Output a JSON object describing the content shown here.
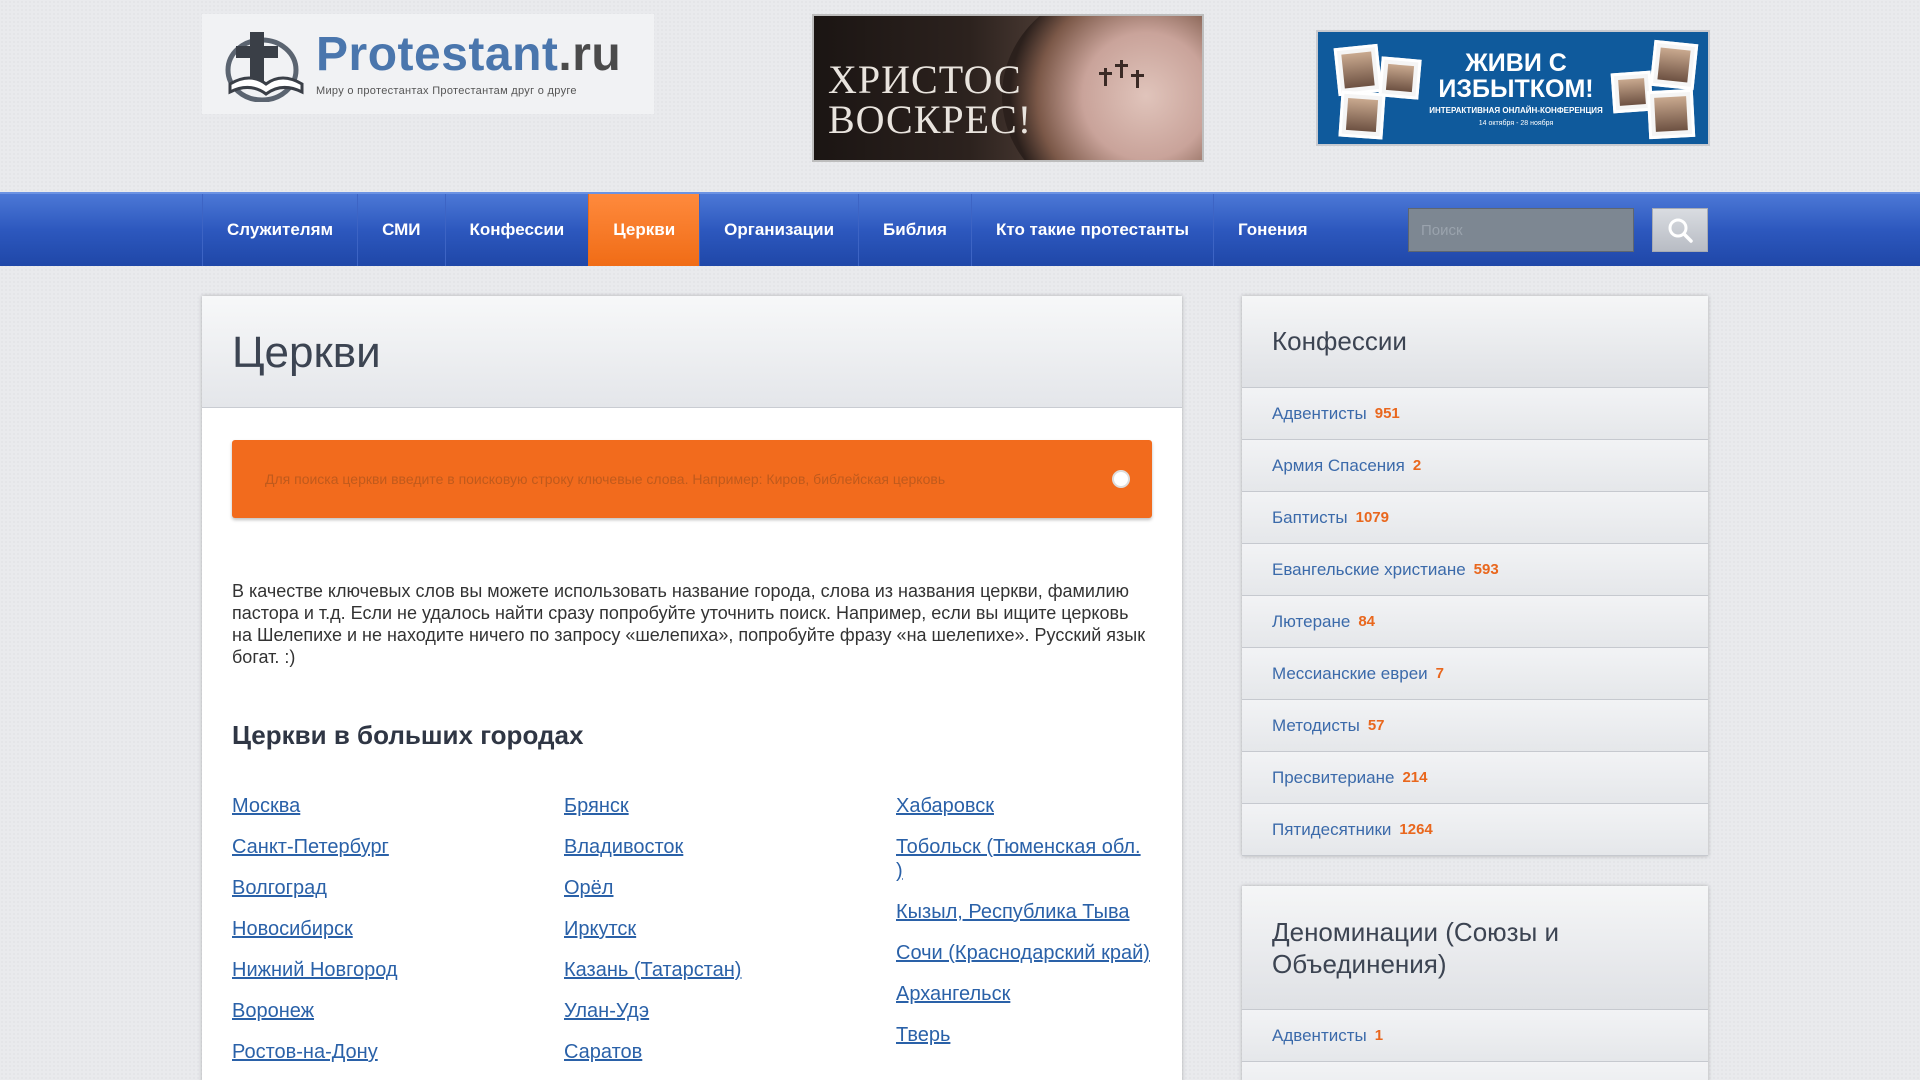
{
  "header": {
    "logo_title": "Protestant",
    "logo_suffix": ".ru",
    "logo_tagline": "Миру о протестантах  Протестантам друг о друге",
    "banner1_line1": "ХРИСТОС",
    "banner1_line2": "ВОСКРЕС!",
    "banner2_line1": "ЖИВИ С",
    "banner2_line2": "ИЗБЫТКОМ!",
    "banner2_sub": "ИНТЕРАКТИВНАЯ ОНЛАЙН-КОНФЕРЕНЦИЯ",
    "banner2_date": "14 октября - 28 ноября"
  },
  "nav": {
    "items": [
      {
        "label": "Служителям"
      },
      {
        "label": "СМИ"
      },
      {
        "label": "Конфессии"
      },
      {
        "label": "Церкви"
      },
      {
        "label": "Организации"
      },
      {
        "label": "Библия"
      },
      {
        "label": "Кто такие протестанты"
      },
      {
        "label": "Гонения"
      }
    ],
    "active_index": 3,
    "search_placeholder": "Поиск"
  },
  "main": {
    "title": "Церкви",
    "search_hint": "Для поиска церкви введите в поисковую строку ключевые слова. Например: Киров, библейская церковь",
    "description": "В качестве ключевых слов вы можете использовать название города, слова из названия церкви, фамилию пастора и т.д. Если не удалось найти сразу попробуйте уточнить поиск. Например, если вы ищите церковь на Шелепихе и не находите ничего по запросу «шелепиха», попробуйте фразу «на шелепихе». Русский язык богат. :)",
    "cities_title": "Церкви в больших городах",
    "cities_col1": [
      "Москва",
      "Санкт-Петербург",
      "Волгоград",
      "Новосибирск",
      "Нижний Новгород",
      "Воронеж",
      "Ростов-на-Дону"
    ],
    "cities_col2": [
      "Брянск",
      "Владивосток",
      "Орёл",
      "Иркутск",
      "Казань (Татарстан)",
      "Улан-Удэ",
      "Саратов"
    ],
    "cities_col3": [
      "Хабаровск",
      "Тобольск (Тюменская обл. )",
      "Кызыл, Республика Тыва",
      "Сочи (Краснодарский край)",
      "Архангельск",
      "Тверь"
    ]
  },
  "sidebar": {
    "confessions_title": "Конфессии",
    "confessions": [
      {
        "name": "Адвентисты",
        "count": "951"
      },
      {
        "name": "Армия Спасения",
        "count": "2"
      },
      {
        "name": "Баптисты",
        "count": "1079"
      },
      {
        "name": "Евангельские христиане",
        "count": "593"
      },
      {
        "name": "Лютеране",
        "count": "84"
      },
      {
        "name": "Мессианские евреи",
        "count": "7"
      },
      {
        "name": "Методисты",
        "count": "57"
      },
      {
        "name": "Пресвитериане",
        "count": "214"
      },
      {
        "name": "Пятидесятники",
        "count": "1264"
      }
    ],
    "denominations_title": "Деноминации (Союзы и Объединения)",
    "denominations": [
      {
        "name": "Адвентисты",
        "count": "1"
      }
    ]
  },
  "colors": {
    "nav_blue": "#2d58be",
    "accent_orange": "#f26b1d",
    "link_blue": "#2a61a8"
  },
  "icons": {
    "search": "search-icon",
    "logo": "cross-book-icon"
  }
}
